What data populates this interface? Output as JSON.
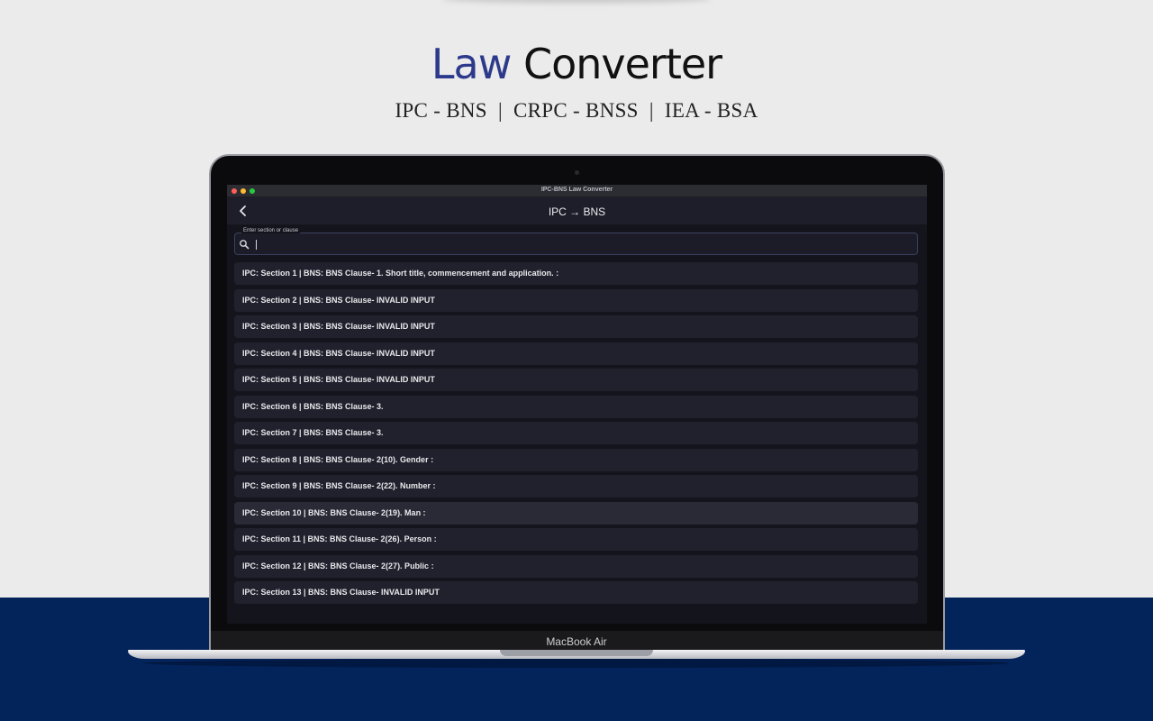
{
  "header": {
    "title_accent": "Law",
    "title_rest": "Converter",
    "subtitle": "IPC - BNS  |  CRPC - BNSS  |  IEA - BSA"
  },
  "device": {
    "label": "MacBook Air"
  },
  "window": {
    "title": "IPC-BNS Law Converter"
  },
  "appbar": {
    "title": "IPC → BNS",
    "back_icon": "chevron-left-icon"
  },
  "search": {
    "label": "Enter section or clause",
    "value": "",
    "icon": "search-icon"
  },
  "results": [
    "IPC: Section 1 | BNS: BNS Clause- 1. Short title, commencement and application. :",
    "IPC: Section 2 | BNS: BNS Clause- INVALID INPUT",
    "IPC: Section 3 | BNS: BNS Clause- INVALID INPUT",
    "IPC: Section 4 | BNS: BNS Clause- INVALID INPUT",
    "IPC: Section 5 | BNS: BNS Clause- INVALID INPUT",
    "IPC: Section 6 | BNS: BNS Clause- 3.",
    "IPC: Section 7 | BNS: BNS Clause- 3.",
    "IPC: Section 8 | BNS: BNS Clause- 2(10). Gender :",
    "IPC: Section 9 | BNS: BNS Clause- 2(22). Number :",
    "IPC: Section 10 | BNS: BNS Clause- 2(19). Man :",
    "IPC: Section 11 | BNS: BNS Clause- 2(26). Person :",
    "IPC: Section 12 | BNS: BNS Clause- 2(27). Public :",
    "IPC: Section 13 | BNS: BNS Clause- INVALID INPUT"
  ],
  "colors": {
    "brand_accent": "#2d3a8c",
    "band": "#03235b",
    "app_background": "#14151c"
  }
}
